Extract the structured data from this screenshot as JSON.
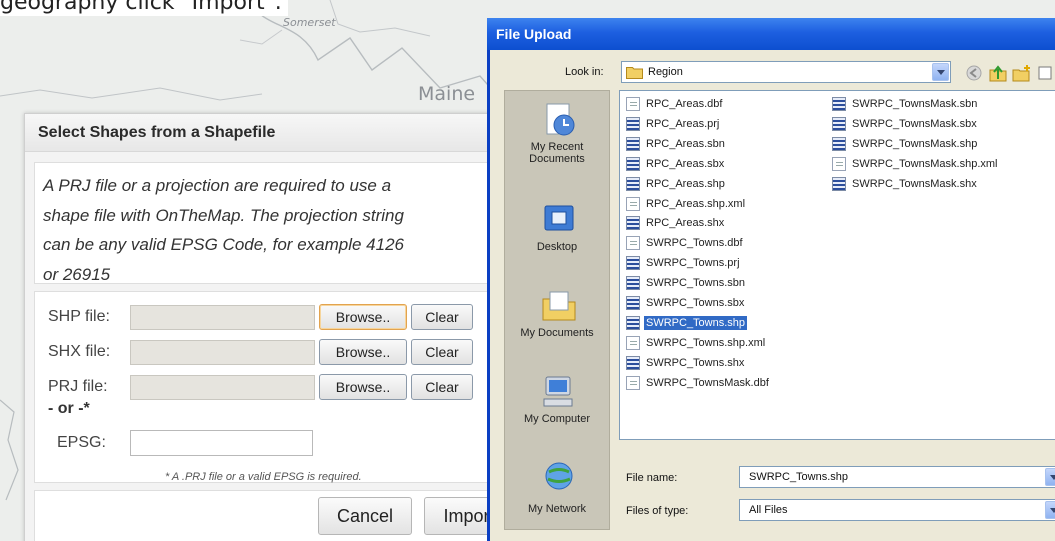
{
  "page": {
    "caption": "geography click \"Import\"."
  },
  "map": {
    "labels": [
      "Somerset",
      "Maine"
    ]
  },
  "shape_dialog": {
    "title": "Select Shapes from a Shapefile",
    "info_lines": [
      "A PRJ file or a projection are required to use a",
      "shape file with OnTheMap. The projection string",
      "can be any valid EPSG Code, for example 4126",
      "or 26915"
    ],
    "rows": [
      {
        "label": "SHP file:",
        "browse": "Browse..",
        "clear": "Clear"
      },
      {
        "label": "SHX file:",
        "browse": "Browse..",
        "clear": "Clear"
      },
      {
        "label": "PRJ file:",
        "browse": "Browse..",
        "clear": "Clear"
      }
    ],
    "or_label": "- or -*",
    "epsg_label": "EPSG:",
    "note": "* A .PRJ file or a valid EPSG is required.",
    "cancel": "Cancel",
    "import": "Import"
  },
  "file_upload": {
    "title": "File Upload",
    "look_in_label": "Look in:",
    "look_in_value": "Region",
    "places": [
      "My Recent Documents",
      "Desktop",
      "My Documents",
      "My Computer",
      "My Network"
    ],
    "files_col1": [
      {
        "name": "RPC_Areas.dbf",
        "icon": "doc"
      },
      {
        "name": "RPC_Areas.prj",
        "icon": "grid"
      },
      {
        "name": "RPC_Areas.sbn",
        "icon": "grid"
      },
      {
        "name": "RPC_Areas.sbx",
        "icon": "grid"
      },
      {
        "name": "RPC_Areas.shp",
        "icon": "grid"
      },
      {
        "name": "RPC_Areas.shp.xml",
        "icon": "doc"
      },
      {
        "name": "RPC_Areas.shx",
        "icon": "grid"
      },
      {
        "name": "SWRPC_Towns.dbf",
        "icon": "doc"
      },
      {
        "name": "SWRPC_Towns.prj",
        "icon": "grid"
      },
      {
        "name": "SWRPC_Towns.sbn",
        "icon": "grid"
      },
      {
        "name": "SWRPC_Towns.sbx",
        "icon": "grid"
      },
      {
        "name": "SWRPC_Towns.shp",
        "icon": "grid"
      },
      {
        "name": "SWRPC_Towns.shp.xml",
        "icon": "doc"
      },
      {
        "name": "SWRPC_Towns.shx",
        "icon": "grid"
      },
      {
        "name": "SWRPC_TownsMask.dbf",
        "icon": "doc"
      }
    ],
    "files_col2": [
      {
        "name": "SWRPC_TownsMask.sbn",
        "icon": "grid"
      },
      {
        "name": "SWRPC_TownsMask.sbx",
        "icon": "grid"
      },
      {
        "name": "SWRPC_TownsMask.shp",
        "icon": "grid"
      },
      {
        "name": "SWRPC_TownsMask.shp.xml",
        "icon": "doc"
      },
      {
        "name": "SWRPC_TownsMask.shx",
        "icon": "grid"
      }
    ],
    "selected_file": "SWRPC_Towns.shp",
    "file_name_label": "File name:",
    "file_name_value": "SWRPC_Towns.shp",
    "files_of_type_label": "Files of type:",
    "files_of_type_value": "All Files",
    "colors": {
      "titlebar": "#0d4fd0",
      "selection": "#316ac5"
    },
    "toolbar_icons": [
      "back-icon",
      "up-folder-icon",
      "new-folder-icon",
      "view-menu-icon"
    ]
  }
}
